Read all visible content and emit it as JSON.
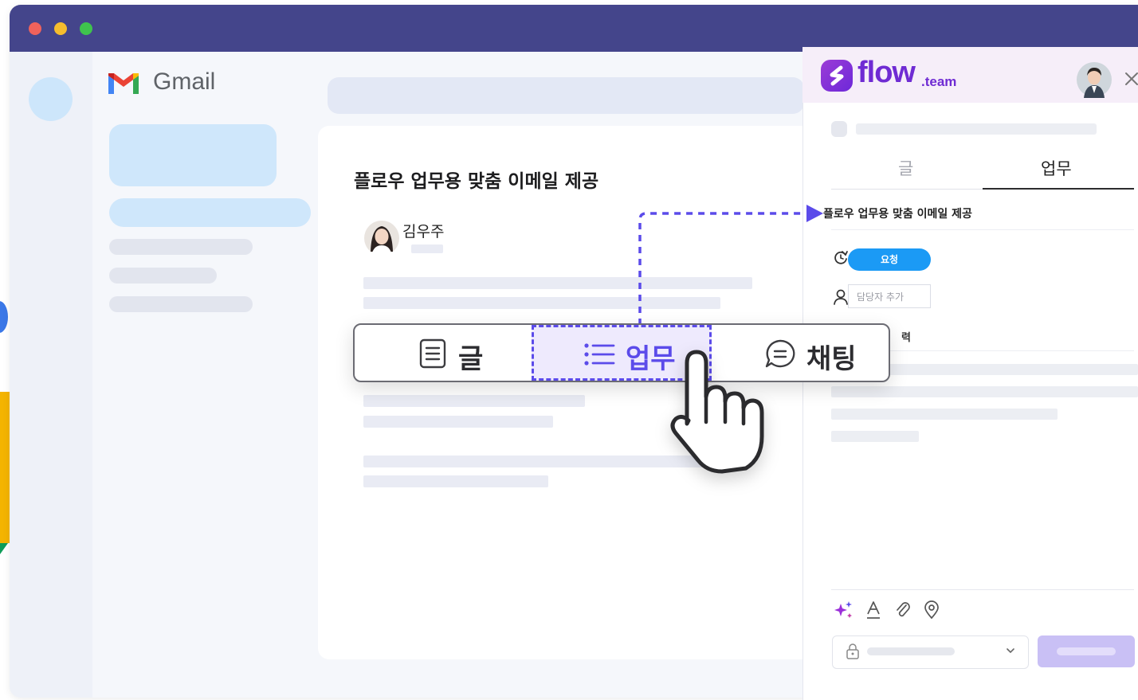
{
  "gmail": {
    "brand": "Gmail",
    "email": {
      "subject": "플로우 업무용 맞춤 이메일 제공",
      "sender": "김우주"
    }
  },
  "flow_panel": {
    "brand": "flow",
    "brand_suffix": ".team",
    "tabs": [
      {
        "label": "글",
        "active": false
      },
      {
        "label": "업무",
        "active": true
      }
    ],
    "task_title": "플로우 업무용 맞춤 이메일 제공",
    "status_badge": "요청",
    "assignee_placeholder": "담당자 추가",
    "partial_label": "력"
  },
  "float_tabs": [
    {
      "label": "글",
      "icon": "document-icon",
      "selected": false
    },
    {
      "label": "업무",
      "icon": "list-icon",
      "selected": true
    },
    {
      "label": "채팅",
      "icon": "chat-bubble-icon",
      "selected": false
    }
  ],
  "colors": {
    "titlebar": "#44458b",
    "flow_purple": "#6f2bd3",
    "status_blue": "#1b9af5",
    "selection_dashed": "#5b4bea",
    "submit_button": "#c9c0f5"
  }
}
